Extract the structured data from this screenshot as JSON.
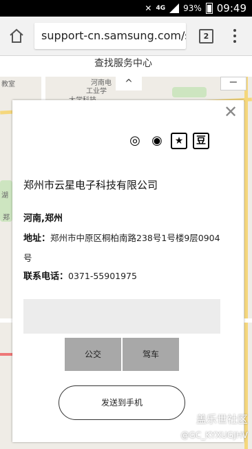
{
  "status_bar": {
    "network": "4G",
    "battery": "93%",
    "time": "09:49"
  },
  "browser": {
    "url": "support-cn.samsung.com/s",
    "tab_count": "2"
  },
  "page": {
    "header_title": "查找服务中心",
    "map_labels": [
      "教室",
      "河南电",
      "工业学",
      "大学科技",
      "湖",
      "郑"
    ],
    "zoom_label": "−",
    "collapse_label": "^"
  },
  "panel": {
    "close_label": "✕",
    "share_icons": [
      "weibo-icon",
      "wechat-icon",
      "star-icon",
      "douban-icon"
    ],
    "share_glyphs": [
      "◎",
      "◉",
      "★",
      "豆"
    ],
    "company": "郑州市云星电子科技有限公司",
    "region": "河南,郑州",
    "address_label": "地址：",
    "address": "郑州市中原区桐柏南路238号1号楼9层0904号",
    "tel_label": "联系电话：",
    "tel": "0371-55901975",
    "mode_bus": "公交",
    "mode_drive": "驾车",
    "send_button": "发送到手机"
  },
  "watermark": {
    "brand": "盖乐世社区",
    "user": "@GC_KYXUGJHV"
  }
}
